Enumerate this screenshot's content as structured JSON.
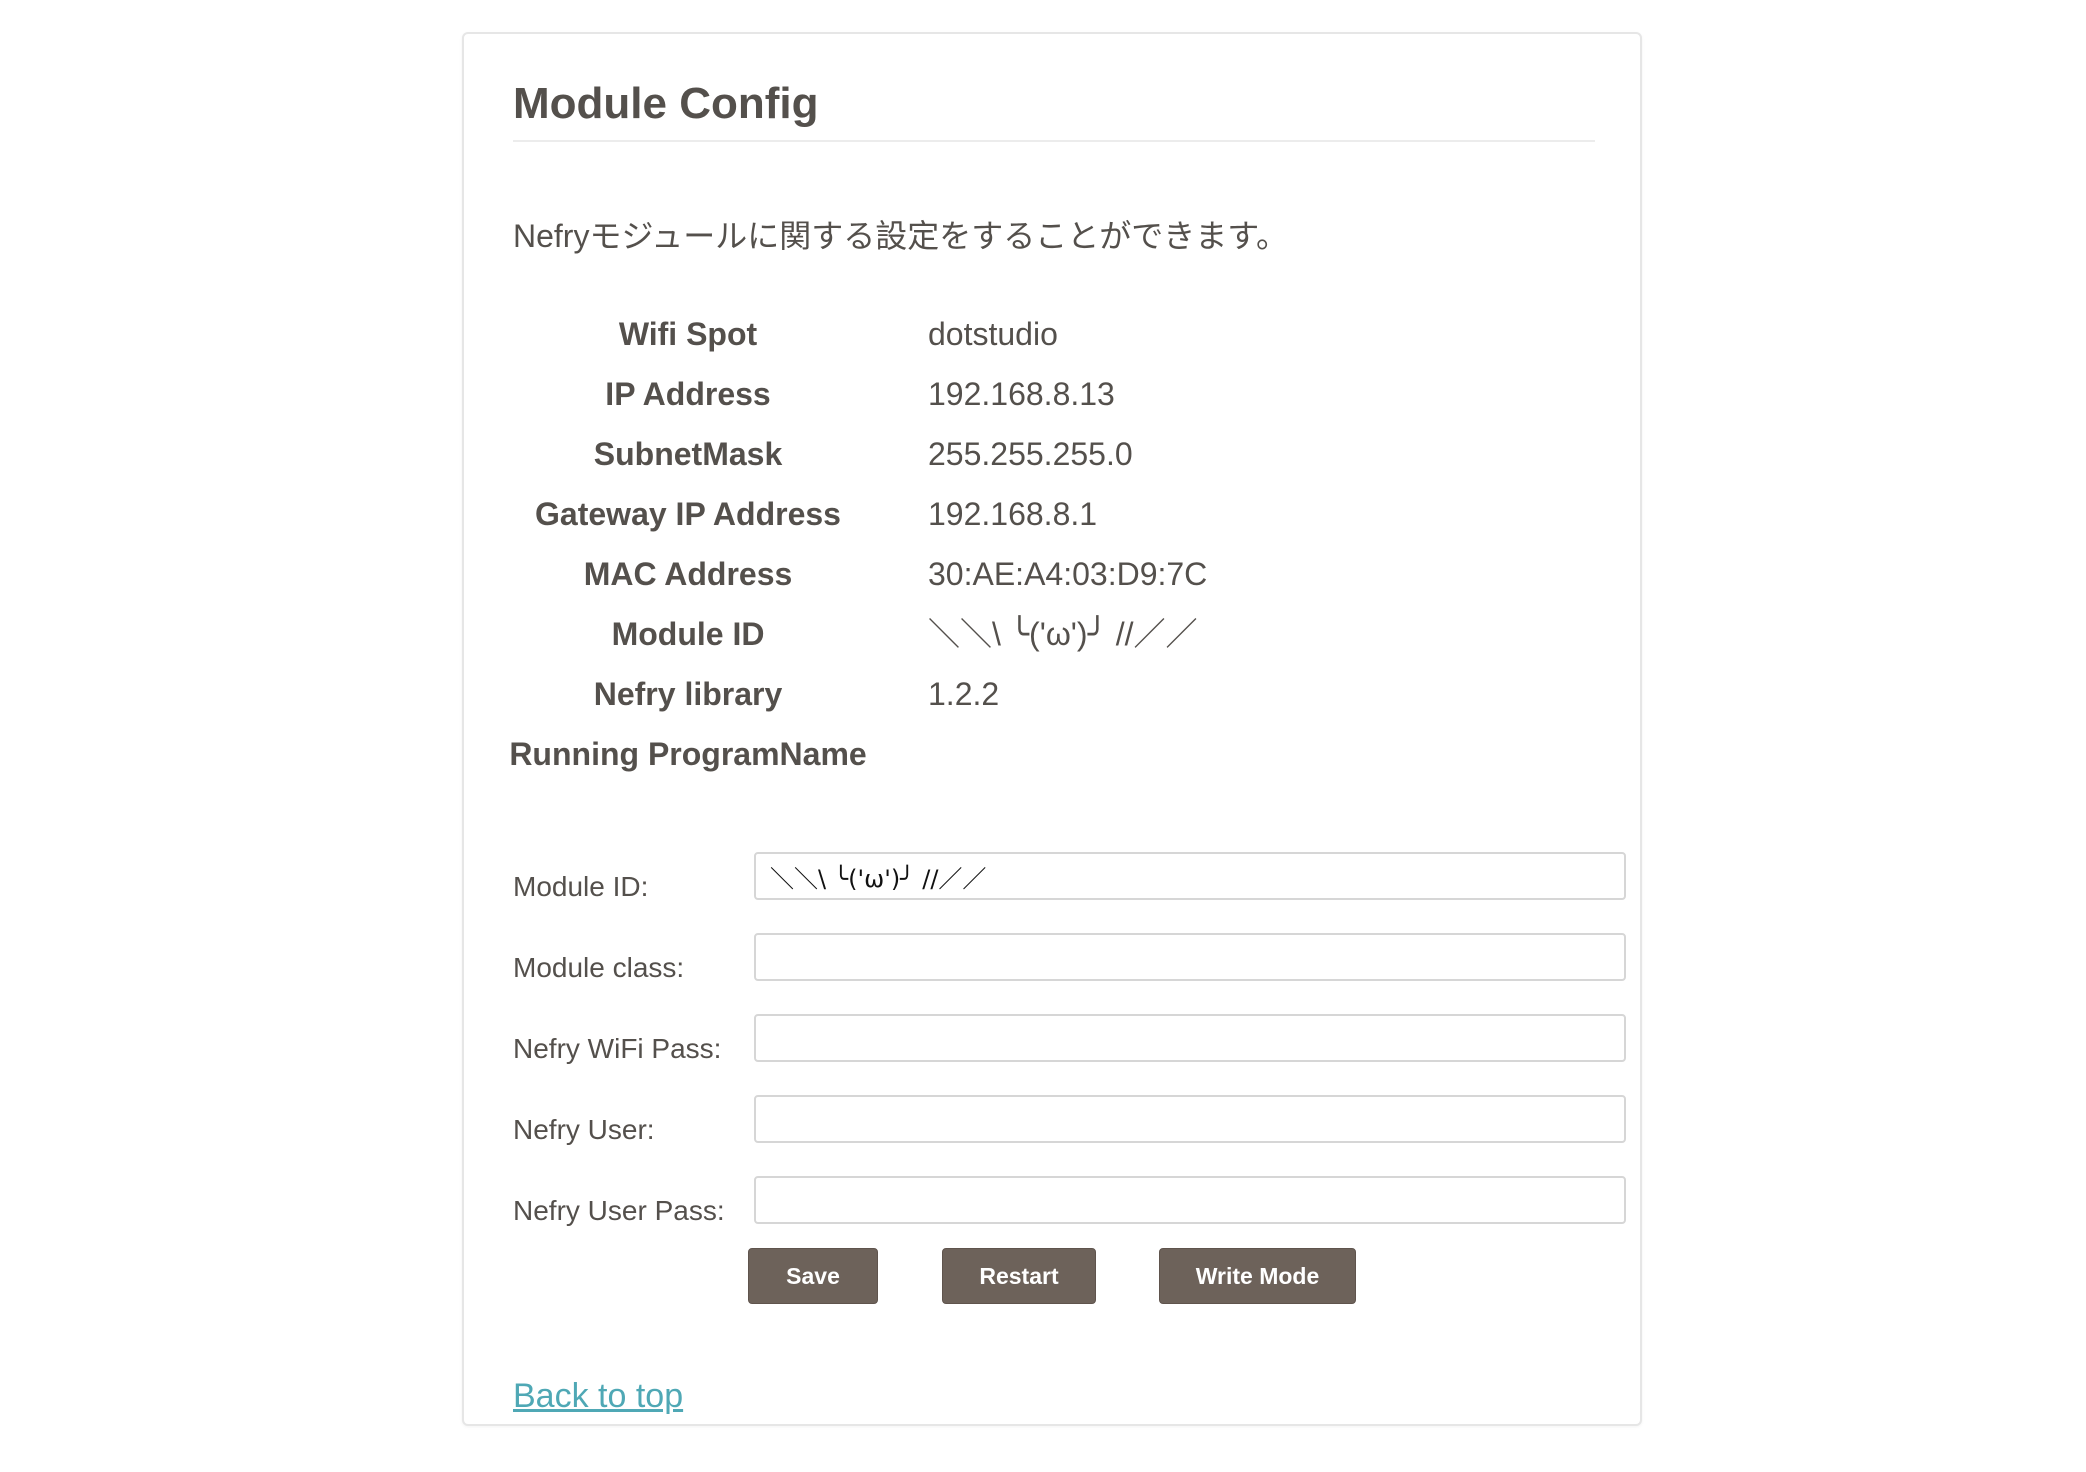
{
  "page": {
    "title": "Module Config",
    "description": "Nefryモジュールに関する設定をすることができます。"
  },
  "info": [
    {
      "label": "Wifi Spot",
      "value": "dotstudio"
    },
    {
      "label": "IP Address",
      "value": "192.168.8.13"
    },
    {
      "label": "SubnetMask",
      "value": "255.255.255.0"
    },
    {
      "label": "Gateway IP Address",
      "value": "192.168.8.1"
    },
    {
      "label": "MAC Address",
      "value": "30:AE:A4:03:D9:7C"
    },
    {
      "label": "Module ID",
      "value": "＼＼\\ ╰('ω')╯ //／／"
    },
    {
      "label": "Nefry library",
      "value": "1.2.2"
    },
    {
      "label": "Running ProgramName",
      "value": ""
    }
  ],
  "form": {
    "module_id": {
      "label": "Module ID:",
      "value": "＼＼\\ ╰('ω')╯ //／／"
    },
    "module_class": {
      "label": "Module class:",
      "value": ""
    },
    "wifi_pass": {
      "label": "Nefry WiFi Pass:",
      "value": ""
    },
    "user": {
      "label": "Nefry User:",
      "value": ""
    },
    "user_pass": {
      "label": "Nefry User Pass:",
      "value": ""
    }
  },
  "buttons": {
    "save": "Save",
    "restart": "Restart",
    "write_mode": "Write Mode"
  },
  "links": {
    "back_to_top": "Back to top"
  }
}
